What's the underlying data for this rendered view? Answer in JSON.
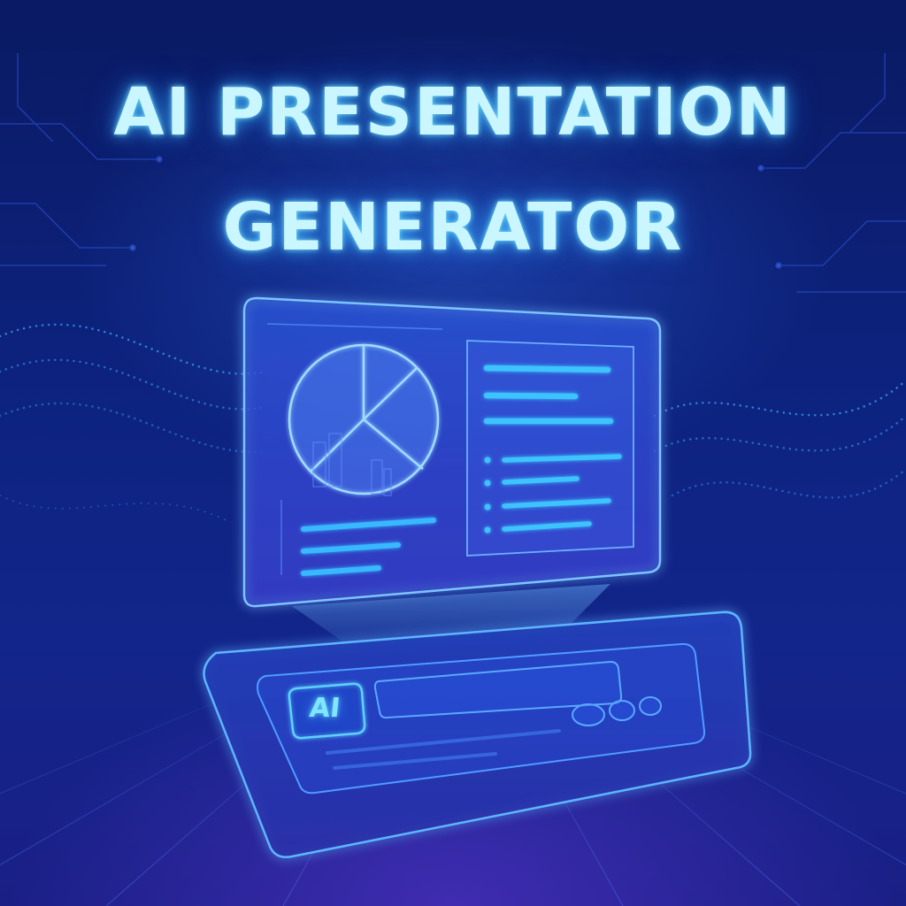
{
  "title": {
    "line1": "AI PRESENTATION",
    "line2": "GENERATOR"
  },
  "input_panel": {
    "badge_label": "AI"
  },
  "colors": {
    "title_glow": "#c9f6ff",
    "accent_cyan": "#38c8ff",
    "panel_border": "#5fb4ff",
    "background_top": "#0a1a63",
    "background_bottom": "#1a1f86"
  },
  "icons": [
    "pie-chart-icon",
    "bar-chart-icon",
    "bullet-list-icon",
    "ai-badge-icon"
  ]
}
